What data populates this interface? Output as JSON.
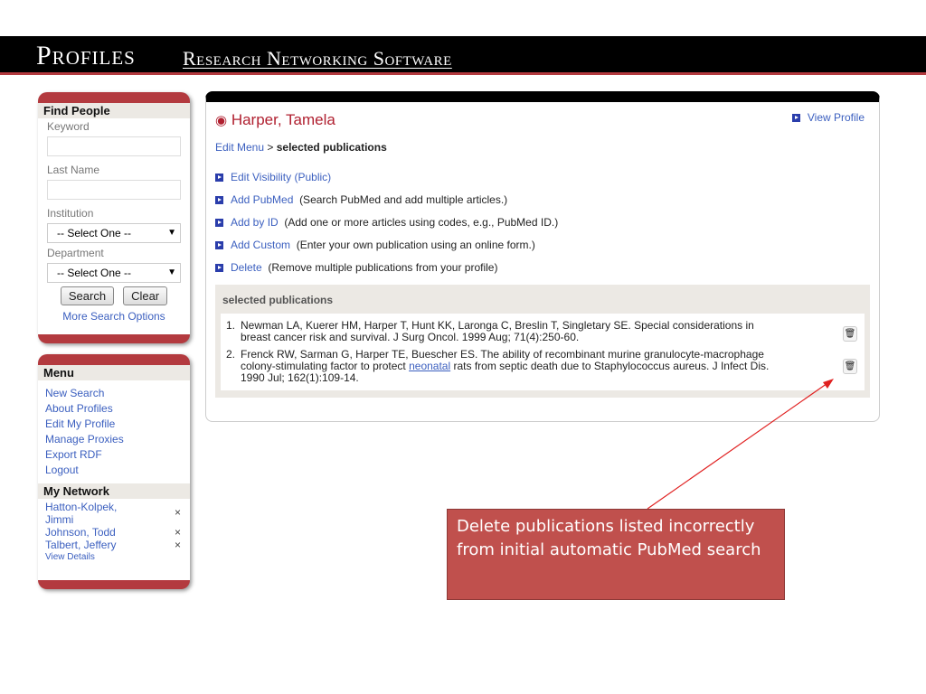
{
  "header": {
    "title": "Profiles",
    "subtitle": "Research Networking Software"
  },
  "find": {
    "title": "Find People",
    "keyword": "Keyword",
    "last_name": "Last Name",
    "institution": "Institution",
    "institution_value": "-- Select One --",
    "department": "Department",
    "department_value": "-- Select One --",
    "search": "Search",
    "clear": "Clear",
    "more": "More Search Options"
  },
  "menu": {
    "title": "Menu",
    "items": [
      "New Search",
      "About Profiles",
      "Edit My Profile",
      "Manage Proxies",
      "Export RDF",
      "Logout"
    ]
  },
  "network": {
    "title": "My Network",
    "people": [
      "Hatton-Kolpek, Jimmi",
      "Johnson, Todd",
      "Talbert, Jeffery"
    ],
    "remove": "×",
    "details": "View Details"
  },
  "main": {
    "name": "Harper, Tamela",
    "view_profile": "View Profile",
    "breadcrumb_link": "Edit Menu",
    "breadcrumb_sep": " > ",
    "breadcrumb_current": "selected publications",
    "actions": [
      {
        "label": "Edit Visibility (Public)",
        "desc": ""
      },
      {
        "label": "Add PubMed",
        "desc": "(Search PubMed and add multiple articles.)"
      },
      {
        "label": "Add by ID",
        "desc": "(Add one or more articles using codes, e.g., PubMed ID.)"
      },
      {
        "label": "Add Custom",
        "desc": "(Enter your own publication using an online form.)"
      },
      {
        "label": "Delete",
        "desc": "(Remove multiple publications from your profile)"
      }
    ],
    "pubs_title": "selected publications",
    "pubs": [
      {
        "n": "1.",
        "text": "Newman LA, Kuerer HM, Harper T, Hunt KK, Laronga C, Breslin T, Singletary SE. Special considerations in breast cancer risk and survival. J Surg Oncol. 1999 Aug; 71(4):250-60."
      },
      {
        "n": "2.",
        "pre": "Frenck RW, Sarman G, Harper TE, Buescher ES. The ability of recombinant murine granulocyte-macrophage colony-stimulating factor to protect ",
        "link": "neonatal",
        "post": " rats from septic death due to Staphylococcus aureus. J Infect Dis. 1990 Jul; 162(1):109-14."
      }
    ]
  },
  "callout": "Delete publications listed incorrectly from initial automatic PubMed search"
}
